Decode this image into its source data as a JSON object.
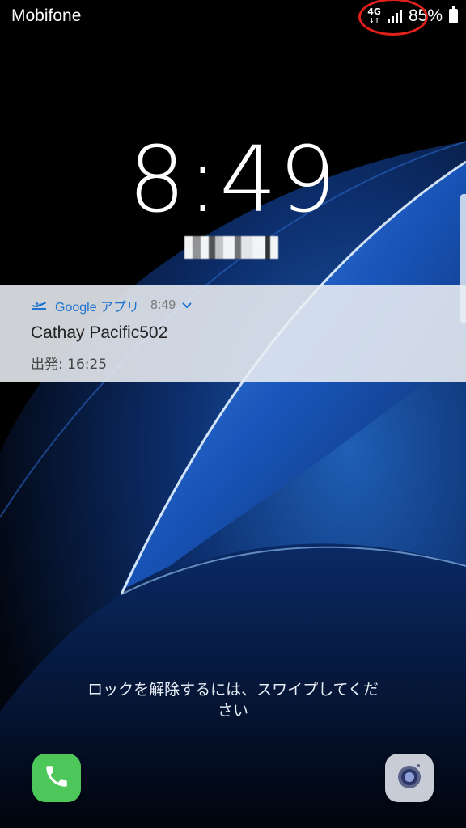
{
  "status": {
    "carrier": "Mobifone",
    "network": "4G",
    "battery_percent": "85%",
    "battery_level": 0.85
  },
  "lockscreen": {
    "time": "8:49"
  },
  "notification": {
    "app_name": "Google アプリ",
    "time": "8:49",
    "title": "Cathay Pacific502",
    "text": "出発: 16:25",
    "icon": "airplane-icon"
  },
  "unlock_hint": "ロックを解除するには、スワイプしてください",
  "shortcuts": {
    "left_icon": "phone-icon",
    "right_icon": "camera-icon"
  },
  "colors": {
    "accent": "#1e73d2",
    "phone_green": "#4ec75a",
    "highlight_red": "#e0201b"
  }
}
